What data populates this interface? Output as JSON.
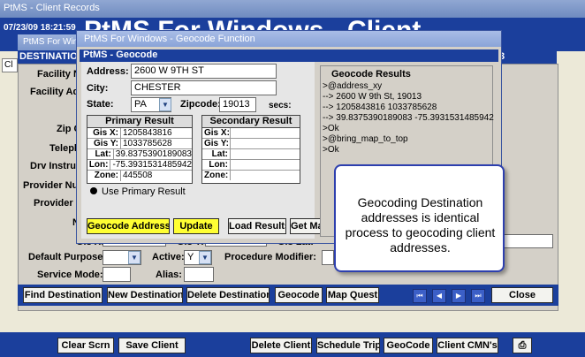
{
  "main": {
    "title": "PtMS - Client Records",
    "datetime": "07/23/09  18:21:59",
    "big_title_fragment": "PtMS For Windows - Client",
    "cl_fragment": "Cl",
    "destination_fragment": "DESTINATION",
    "right_fragment": "3",
    "labels": {
      "facility_name": "Facility Na",
      "facility_addr": "Facility Add",
      "zip": "Zip C",
      "telephone": "Teleph",
      "drv_instruct": "Drv Instruct",
      "provider_num": "Provider Num",
      "provider_f": "Provider F",
      "n": "N",
      "gis_x": "Gis X:",
      "gis_y": "Gis Y:",
      "gis_lat": "Gis Lat:",
      "default_purpose": "Default Purpose:",
      "active": "Active:",
      "procedure_modifier": "Procedure Modifier:",
      "service_mode": "Service Mode:",
      "alias": "Alias:"
    },
    "values": {
      "gis_x": "1205843816",
      "gis_y": "1033785628",
      "active": "Y"
    },
    "dest_buttons": [
      "Find Destination",
      "New Destination",
      "Delete Destination",
      "Geocode",
      "Map Quest"
    ],
    "close_label": "Close",
    "bottom_buttons": [
      "Clear Scrn",
      "Save Client",
      "Delete Client",
      "Schedule Trip",
      "GeoCode",
      "Client CMN's"
    ]
  },
  "mid_window": {
    "title": "PtMS For Windo"
  },
  "geocode": {
    "window_title": "PtMS For Windows - Geocode Function",
    "panel_title": "PtMS - Geocode",
    "address_label": "Address:",
    "address": "2600 W 9TH ST",
    "city_label": "City:",
    "city": "CHESTER",
    "state_label": "State:",
    "state": "PA",
    "zip_label": "Zipcode:",
    "zip": "19013",
    "secs_label": "secs:",
    "primary_header": "Primary Result",
    "secondary_header": "Secondary Result",
    "row_labels": [
      "Gis X:",
      "Gis Y:",
      "Lat:",
      "Lon:",
      "Zone:"
    ],
    "primary_values": [
      "1205843816",
      "1033785628",
      "39.8375390189083",
      "-75.3931531485942",
      "445508"
    ],
    "use_primary_label": "Use Primary Result",
    "results_title": "Geocode Results",
    "results_lines": [
      ">@address_xy",
      "--> 2600 W 9th St, 19013",
      "--> 1205843816 1033785628",
      "--> 39.8375390189083 -75.3931531485942",
      ">Ok",
      ">@bring_map_to_top",
      ">Ok"
    ],
    "buttons": {
      "geocode_address": "Geocode Address",
      "update": "Update",
      "load_results": "Load Results",
      "get_manual": "Get Manu"
    }
  },
  "callout": {
    "text": "Geocoding Destination addresses is identical process to geocoding client addresses."
  }
}
